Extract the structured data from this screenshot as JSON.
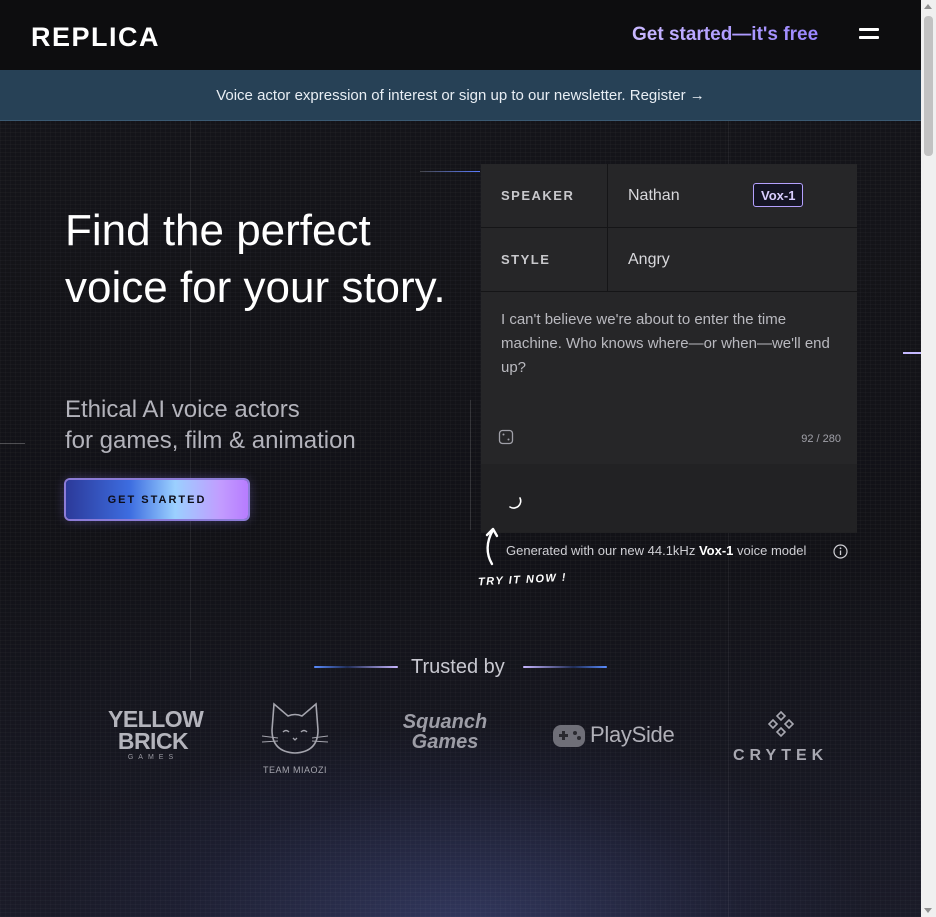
{
  "header": {
    "logo": "REPLICA",
    "cta": "Get started—it's free"
  },
  "banner": {
    "text": "Voice actor expression of interest or sign up to our newsletter. Register →"
  },
  "hero": {
    "title": "Find the perfect voice for your story.",
    "subtitle_line1": "Ethical AI voice actors",
    "subtitle_line2": "for games, film & animation",
    "button": "GET STARTED"
  },
  "demo": {
    "speaker_label": "SPEAKER",
    "speaker_value": "Nathan",
    "model_badge": "Vox-1",
    "style_label": "STYLE",
    "style_value": "Angry",
    "text": "I can't believe we're about to enter the time machine. Who knows where—or when—we'll end up?",
    "counter": "92 / 280",
    "note_prefix": "Generated with our new 44.1kHz",
    "note_model": "Vox-1",
    "note_suffix": "voice model",
    "try_now": "TRY IT NOW !"
  },
  "trusted": {
    "title": "Trusted by",
    "logos": {
      "yellow_brick_line1": "YELLOW",
      "yellow_brick_line2": "BRICK",
      "yellow_brick_line3": "GAMES",
      "team_miaozi": "TEAM MIAOZI",
      "squanch_line1": "Squanch",
      "squanch_line2": "Games",
      "playside": "PlaySide",
      "crytek": "CRYTEK"
    }
  },
  "colors": {
    "accent": "#a48bff",
    "banner": "#274156",
    "panel": "#262628"
  }
}
